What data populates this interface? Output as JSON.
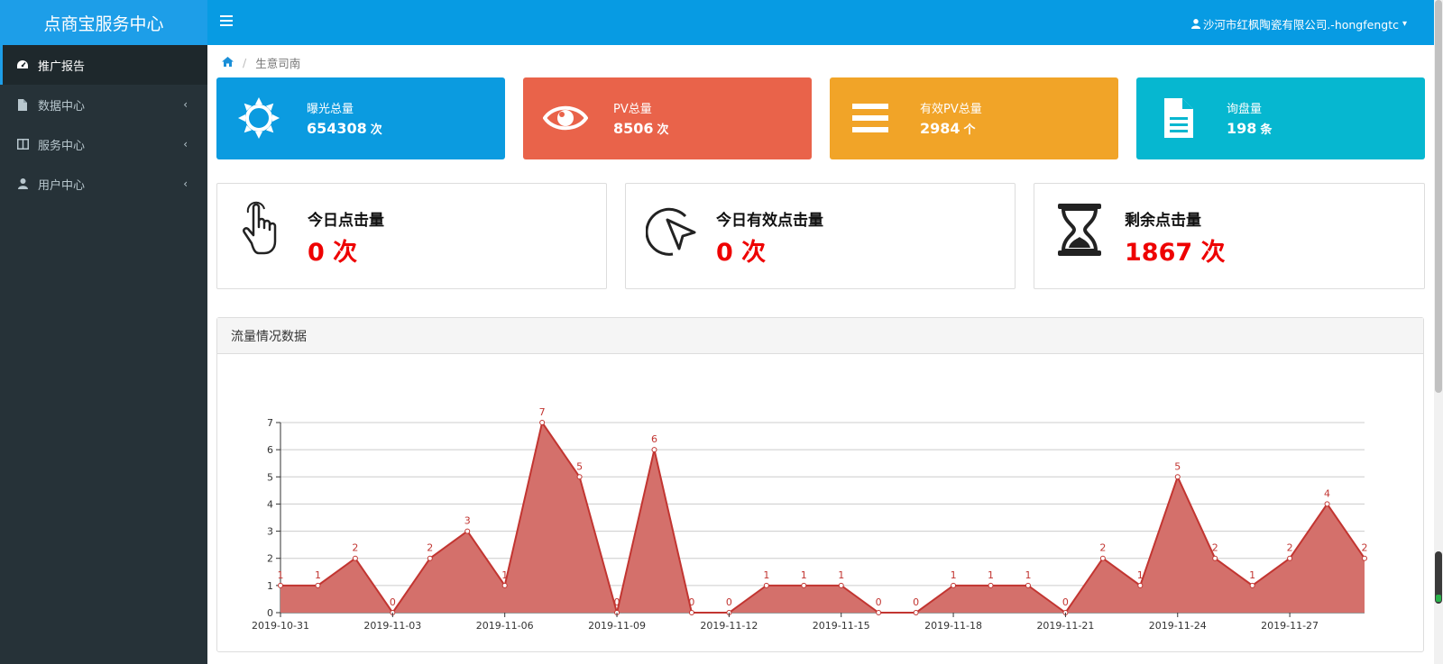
{
  "brand": "点商宝服务中心",
  "sidebar": {
    "items": [
      {
        "label": "推广报告",
        "icon": "dashboard-icon"
      },
      {
        "label": "数据中心",
        "icon": "file-icon"
      },
      {
        "label": "服务中心",
        "icon": "columns-icon"
      },
      {
        "label": "用户中心",
        "icon": "user-icon"
      }
    ]
  },
  "topbar": {
    "user_label": "沙河市红枫陶瓷有限公司.-hongfengtc"
  },
  "breadcrumb": {
    "current": "生意司南"
  },
  "stats": [
    {
      "label": "曝光总量",
      "value": "654308",
      "unit": "次",
      "color": "#0b9be0",
      "icon": "sun-icon"
    },
    {
      "label": "PV总量",
      "value": "8506",
      "unit": "次",
      "color": "#e9634a",
      "icon": "eye-icon"
    },
    {
      "label": "有效PV总量",
      "value": "2984",
      "unit": "个",
      "color": "#f1a428",
      "icon": "bars-icon"
    },
    {
      "label": "询盘量",
      "value": "198",
      "unit": "条",
      "color": "#06b7d0",
      "icon": "document-icon"
    }
  ],
  "clicks": [
    {
      "title": "今日点击量",
      "value": "0 次",
      "icon": "hand-pointer-icon"
    },
    {
      "title": "今日有效点击量",
      "value": "0 次",
      "icon": "cursor-icon"
    },
    {
      "title": "剩余点击量",
      "value": "1867 次",
      "icon": "hourglass-icon"
    }
  ],
  "panel": {
    "title": "流量情况数据"
  },
  "chart_data": {
    "type": "area",
    "x": [
      "2019-10-31",
      "2019-11-01",
      "2019-11-02",
      "2019-11-03",
      "2019-11-04",
      "2019-11-05",
      "2019-11-06",
      "2019-11-07",
      "2019-11-08",
      "2019-11-09",
      "2019-11-10",
      "2019-11-11",
      "2019-11-12",
      "2019-11-13",
      "2019-11-14",
      "2019-11-15",
      "2019-11-16",
      "2019-11-17",
      "2019-11-18",
      "2019-11-19",
      "2019-11-20",
      "2019-11-21",
      "2019-11-22",
      "2019-11-23",
      "2019-11-24",
      "2019-11-25",
      "2019-11-26",
      "2019-11-27",
      "2019-11-28",
      "2019-11-29"
    ],
    "values": [
      1,
      1,
      2,
      0,
      2,
      3,
      1,
      7,
      5,
      0,
      6,
      0,
      0,
      1,
      1,
      1,
      0,
      0,
      1,
      1,
      1,
      0,
      2,
      1,
      5,
      2,
      1,
      2,
      4,
      2
    ],
    "x_tick_labels": [
      "2019-10-31",
      "2019-11-03",
      "2019-11-06",
      "2019-11-09",
      "2019-11-12",
      "2019-11-15",
      "2019-11-18",
      "2019-11-21",
      "2019-11-24",
      "2019-11-27"
    ],
    "ylim": [
      0,
      7
    ],
    "y_ticks": [
      0,
      1,
      2,
      3,
      4,
      5,
      6,
      7
    ],
    "grid": true,
    "line_color": "#c23531",
    "fill_color": "#d4706b",
    "point_labels": true
  }
}
